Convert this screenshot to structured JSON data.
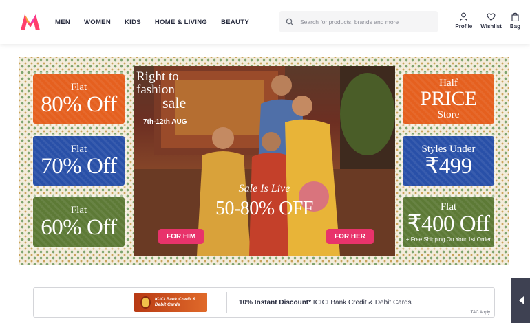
{
  "header": {
    "nav": [
      "MEN",
      "WOMEN",
      "KIDS",
      "HOME & LIVING",
      "BEAUTY"
    ],
    "search_placeholder": "Search for products, brands and more",
    "actions": {
      "profile": "Profile",
      "wishlist": "Wishlist",
      "bag": "Bag"
    },
    "brand_colors": {
      "logo_a": "#ff3f6c",
      "logo_b": "#f7a23b",
      "text": "#282c3f"
    }
  },
  "banner": {
    "left_tiles": [
      {
        "small": "Flat",
        "big": "80% Off",
        "color": "#e5601f"
      },
      {
        "small": "Flat",
        "big": "70% Off",
        "color": "#2950a8"
      },
      {
        "small": "Flat",
        "big": "60% Off",
        "color": "#5d7a36"
      }
    ],
    "right_tiles": [
      {
        "small": "Half",
        "big": "PRICE",
        "small2": "Store",
        "color": "#e5601f"
      },
      {
        "small": "Styles Under",
        "big": "₹499",
        "color": "#2950a8"
      },
      {
        "small": "Flat",
        "big": "₹400 Off",
        "sub": "+ Free Shipping On Your 1st Order",
        "color": "#5d7a36"
      }
    ],
    "hero": {
      "title_1": "Right to",
      "title_2": "fashion",
      "title_3": "sale",
      "date": "7th-12th AUG",
      "live": "Sale Is Live",
      "offer": "50-80% OFF",
      "for_him": "FOR HIM",
      "for_her": "FOR HER"
    }
  },
  "offer_bar": {
    "bank_logo_text": "ICICI Bank Credit & Debit Cards",
    "offer_bold": "10% Instant Discount*",
    "offer_rest": " ICICI Bank Credit & Debit Cards",
    "tnc": "T&C Apply"
  }
}
